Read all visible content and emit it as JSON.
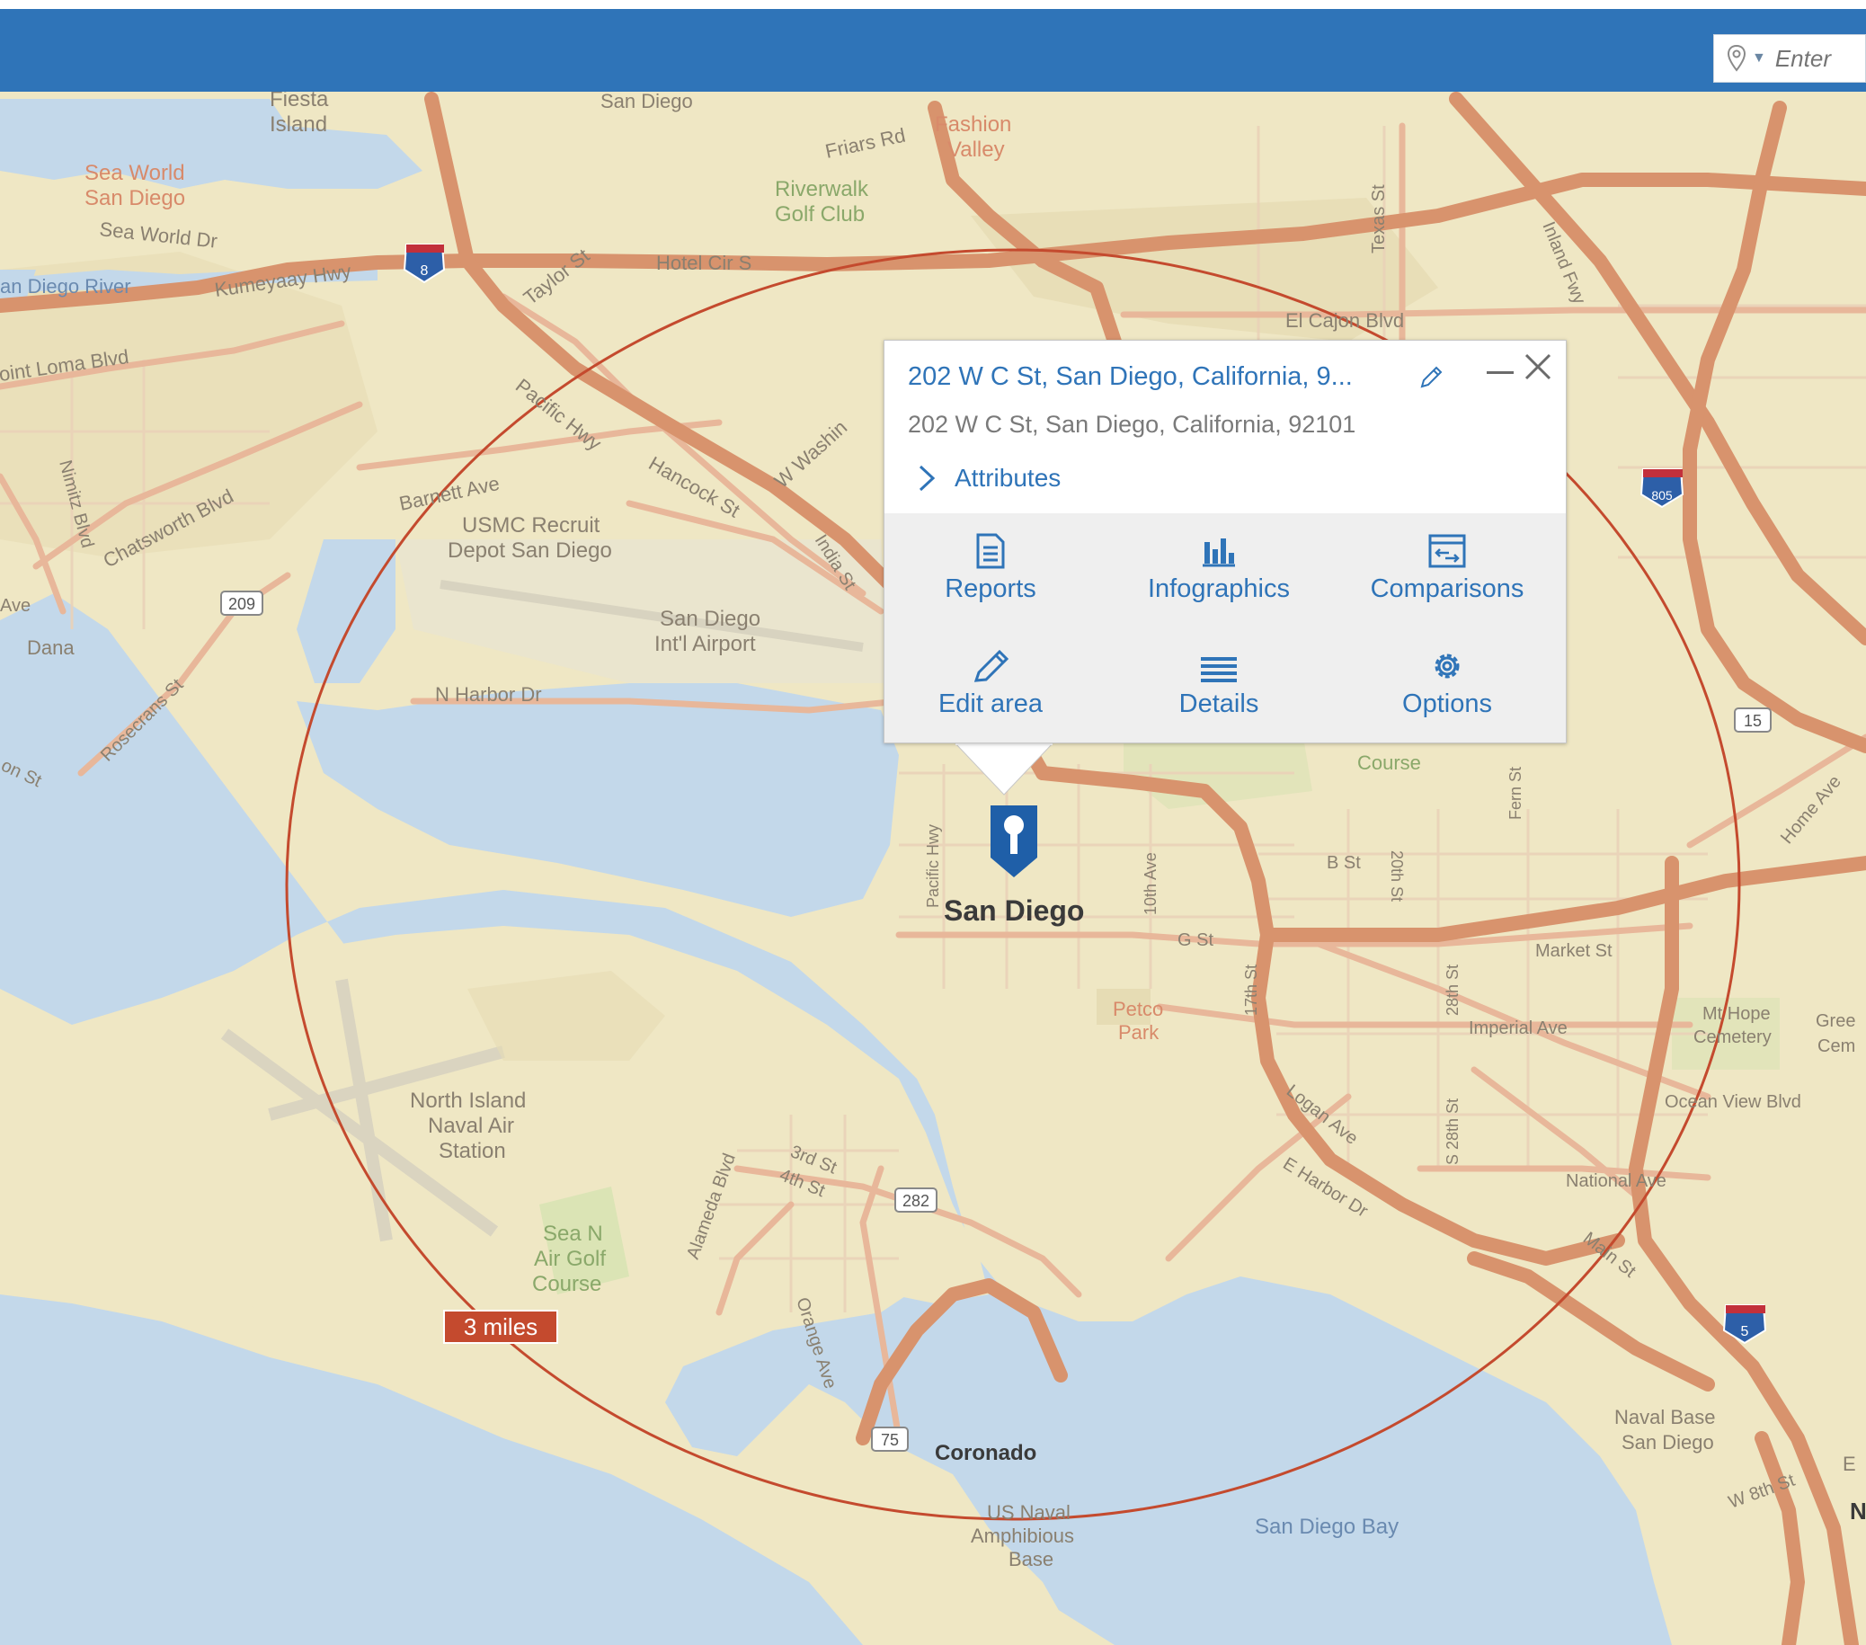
{
  "search": {
    "placeholder": "Enter"
  },
  "popup": {
    "title": "202 W C St, San Diego, California, 9...",
    "address": "202 W C St, San Diego, California, 92101",
    "attributes_label": "Attributes",
    "tools": [
      {
        "label": "Reports",
        "icon": "report-icon"
      },
      {
        "label": "Infographics",
        "icon": "bar-chart-icon"
      },
      {
        "label": "Comparisons",
        "icon": "comparison-icon"
      },
      {
        "label": "Edit area",
        "icon": "pencil-icon"
      },
      {
        "label": "Details",
        "icon": "list-icon"
      },
      {
        "label": "Options",
        "icon": "gear-icon"
      }
    ]
  },
  "map": {
    "ring_label": "3 miles",
    "colors": {
      "land": "#efe7c4",
      "water": "#c3d8ea",
      "highway": "#d8936d",
      "road": "#e8b79a",
      "ring": "#c44a2e",
      "accent": "#2f74b8"
    },
    "labels": {
      "fiesta_island": [
        "Fiesta",
        "Island"
      ],
      "san_diego_top": "San Diego",
      "fashion_valley": [
        "Fashion",
        "Valley"
      ],
      "friars_rd": "Friars Rd",
      "sea_world": [
        "Sea World",
        "San Diego"
      ],
      "sea_world_dr": "Sea World Dr",
      "riverwalk": [
        "Riverwalk",
        "Golf Club"
      ],
      "san_diego_river": "an Diego River",
      "kumeyaay_hwy": "Kumeyaay Hwy",
      "taylor_st": "Taylor St",
      "hotel_cir": "Hotel Cir S",
      "texas_st": "Texas St",
      "inland_fwy": "Inland Fwy",
      "el_cajon": "El Cajon Blvd",
      "point_loma": "oint Loma Blvd",
      "pacific_hwy": "Pacific Hwy",
      "w_washington": "W Washin",
      "barnett_ave": "Barnett Ave",
      "hancock_st": "Hancock St",
      "india_st": "India St",
      "chatsworth": "Chatsworth Blvd",
      "nimitz": "Nimitz Blvd",
      "usmc": [
        "USMC Recruit",
        "Depot San Diego"
      ],
      "airport": [
        "San Diego",
        "Int'l Airport"
      ],
      "dana": "Dana",
      "rosecrans": "Rosecrans St",
      "n_harbor": "N Harbor Dr",
      "on_st": "on St",
      "ave": "Ave",
      "city": "San Diego",
      "pacific_hwy_2": "Pacific Hwy",
      "tenth_ave": "10th Ave",
      "g_st": "G St",
      "b_st": "B St",
      "course": "Course",
      "twentieth_st": "20th St",
      "fern_st": "Fern St",
      "market_st": "Market St",
      "seventeenth_st": "17th St",
      "twenty_eighth": "28th St",
      "imperial": "Imperial Ave",
      "petco": [
        "Petco",
        "Park"
      ],
      "mt_hope": [
        "Mt Hope",
        "Cemetery"
      ],
      "greenwood": [
        "Gree",
        "Cem"
      ],
      "ocean_view": "Ocean View Blvd",
      "logan": "Logan Ave",
      "s_28th": "S 28th St",
      "e_harbor": "E Harbor Dr",
      "national": "National Ave",
      "main_st": "Main St",
      "north_island": [
        "North Island",
        "Naval Air",
        "Station"
      ],
      "sea_n_air": [
        "Sea N",
        "Air Golf",
        "Course"
      ],
      "alameda": "Alameda Blvd",
      "third_st": "3rd St",
      "fourth_st": "4th St",
      "orange_ave": "Orange Ave",
      "coronado": "Coronado",
      "amphibious": [
        "US Naval",
        "Amphibious",
        "Base"
      ],
      "bay": "San Diego Bay",
      "naval_base": [
        "Naval Base",
        "San Diego"
      ],
      "w_8th": "W 8th St",
      "home_ave": "Home Ave",
      "n_edge": "N",
      "e_edge": "E"
    },
    "shields": {
      "i8": "8",
      "i805": "805",
      "i5": "5",
      "sr15": "15",
      "sr209": "209",
      "sr282": "282",
      "sr75": "75"
    }
  }
}
